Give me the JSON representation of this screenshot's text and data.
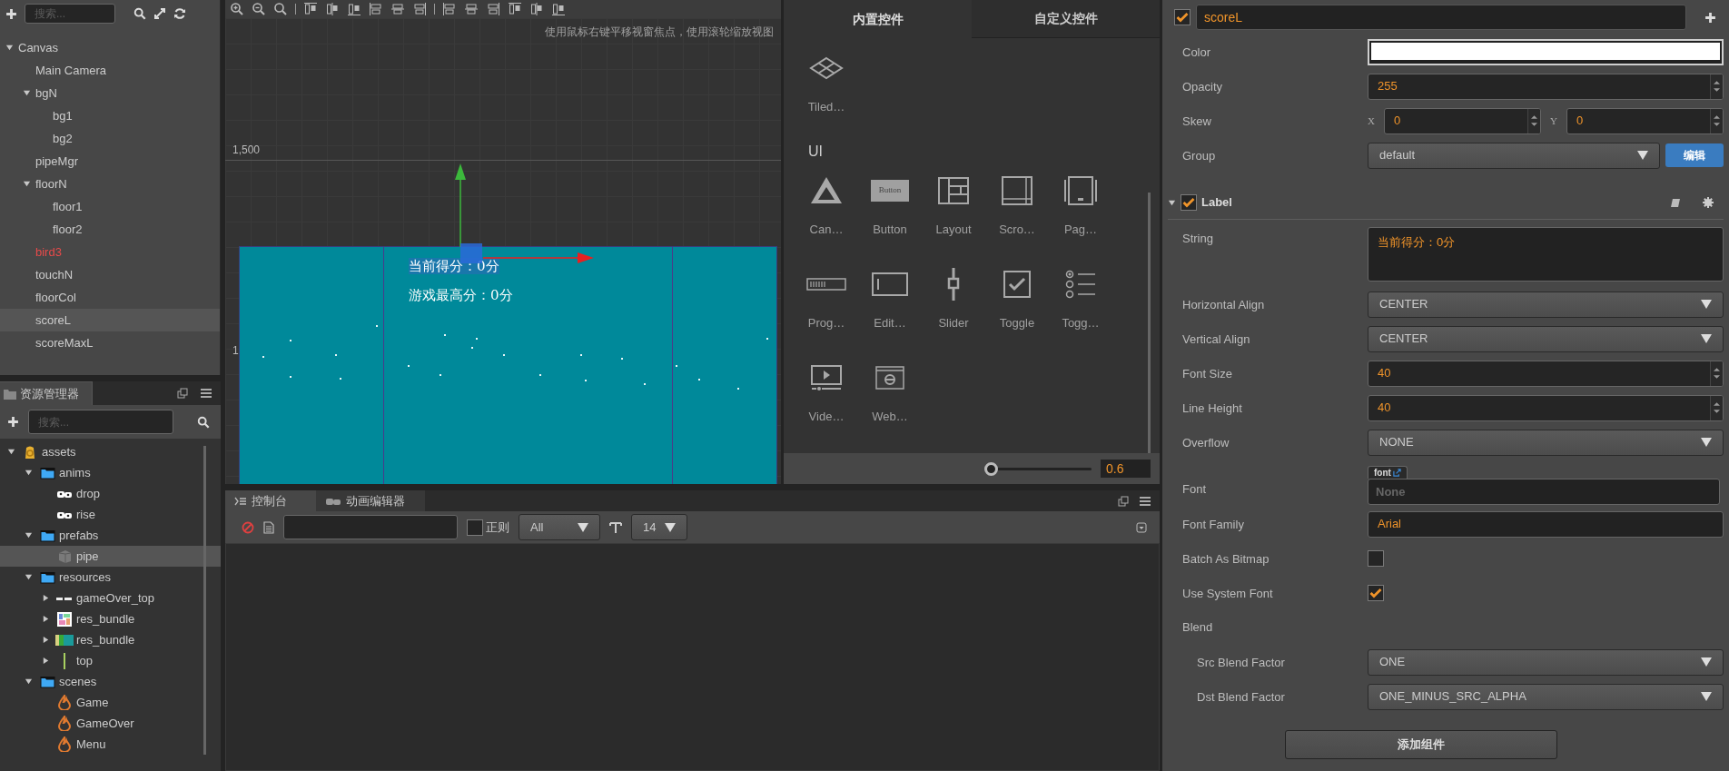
{
  "hierarchy": {
    "search_placeholder": "搜索...",
    "nodes": [
      {
        "name": "Canvas",
        "expanded": true,
        "selected": false,
        "color": "#cccccc",
        "children": [
          {
            "name": "Main Camera",
            "selected": false,
            "color": "#cccccc"
          },
          {
            "name": "bgN",
            "expanded": true,
            "selected": false,
            "color": "#cccccc",
            "children": [
              {
                "name": "bg1",
                "selected": false,
                "color": "#cccccc"
              },
              {
                "name": "bg2",
                "selected": false,
                "color": "#cccccc"
              }
            ]
          },
          {
            "name": "pipeMgr",
            "selected": false,
            "color": "#cccccc"
          },
          {
            "name": "floorN",
            "expanded": true,
            "selected": false,
            "color": "#cccccc",
            "children": [
              {
                "name": "floor1",
                "selected": false,
                "color": "#cccccc"
              },
              {
                "name": "floor2",
                "selected": false,
                "color": "#cccccc"
              }
            ]
          },
          {
            "name": "bird3",
            "selected": false,
            "color": "#e84a4a"
          },
          {
            "name": "touchN",
            "selected": false,
            "color": "#cccccc"
          },
          {
            "name": "floorCol",
            "selected": false,
            "color": "#cccccc"
          },
          {
            "name": "scoreL",
            "selected": true,
            "color": "#cccccc"
          },
          {
            "name": "scoreMaxL",
            "selected": false,
            "color": "#cccccc"
          }
        ]
      }
    ]
  },
  "assets": {
    "title": "资源管理器",
    "search_placeholder": "搜索...",
    "nodes": [
      {
        "name": "assets",
        "kind": "db",
        "expanded": true,
        "selected": false,
        "children": [
          {
            "name": "anims",
            "kind": "folder",
            "expanded": true,
            "selected": false,
            "children": [
              {
                "name": "drop",
                "kind": "anim",
                "selected": false
              },
              {
                "name": "rise",
                "kind": "anim",
                "selected": false
              }
            ]
          },
          {
            "name": "prefabs",
            "kind": "folder",
            "expanded": true,
            "selected": false,
            "children": [
              {
                "name": "pipe",
                "kind": "prefab",
                "selected": true
              }
            ]
          },
          {
            "name": "resources",
            "kind": "folder",
            "expanded": true,
            "selected": false,
            "children": [
              {
                "name": "gameOver_top",
                "kind": "strip",
                "expanded": false,
                "selected": false
              },
              {
                "name": "res_bundle",
                "kind": "atlas",
                "expanded": false,
                "selected": false
              },
              {
                "name": "res_bundle",
                "kind": "sheet",
                "expanded": false,
                "selected": false
              },
              {
                "name": "top",
                "kind": "bar",
                "expanded": false,
                "selected": false
              }
            ]
          },
          {
            "name": "scenes",
            "kind": "folder",
            "expanded": true,
            "selected": false,
            "children": [
              {
                "name": "Game",
                "kind": "scene",
                "selected": false
              },
              {
                "name": "GameOver",
                "kind": "scene",
                "selected": false
              },
              {
                "name": "Menu",
                "kind": "scene",
                "selected": false
              }
            ]
          }
        ]
      }
    ]
  },
  "scene": {
    "hint": "使用鼠标右键平移视窗焦点，使用滚轮缩放视图",
    "ruler_labels": [
      "1,500",
      "1"
    ],
    "labels": [
      {
        "text": "当前得分：0分",
        "selected": true
      },
      {
        "text": "游戏最高分：0分",
        "selected": false
      }
    ]
  },
  "widgets": {
    "tabs": [
      {
        "label": "内置控件",
        "selected": true
      },
      {
        "label": "自定义控件",
        "selected": false
      }
    ],
    "top_items": [
      {
        "label": "Tiled…",
        "kind": "tiled"
      }
    ],
    "section": "UI",
    "items": [
      {
        "label": "Can…",
        "kind": "canvas"
      },
      {
        "label": "Button",
        "kind": "button",
        "icon_text": "Button"
      },
      {
        "label": "Layout",
        "kind": "layout"
      },
      {
        "label": "Scro…",
        "kind": "scrollview"
      },
      {
        "label": "Pag…",
        "kind": "pageview"
      },
      {
        "label": "Prog…",
        "kind": "progressbar"
      },
      {
        "label": "Edit…",
        "kind": "editbox"
      },
      {
        "label": "Slider",
        "kind": "slider"
      },
      {
        "label": "Toggle",
        "kind": "toggle"
      },
      {
        "label": "Togg…",
        "kind": "togglegroup"
      },
      {
        "label": "Vide…",
        "kind": "video"
      },
      {
        "label": "Web…",
        "kind": "webview"
      }
    ],
    "zoom": {
      "level": 0,
      "value": "0.6"
    }
  },
  "console": {
    "tabs": [
      {
        "label": "控制台",
        "kind": "console",
        "selected": true
      },
      {
        "label": "动画编辑器",
        "kind": "animation",
        "selected": false
      }
    ],
    "regex": {
      "label": "正则",
      "checked": false
    },
    "log_level": "All",
    "font_size": "14"
  },
  "inspector": {
    "node": {
      "enabled": true,
      "name": "scoreL"
    },
    "properties": [
      {
        "kind": "color",
        "label": "Color",
        "color": "#ffffff"
      },
      {
        "kind": "number",
        "label": "Opacity",
        "value": "255"
      },
      {
        "kind": "vector",
        "label": "Skew",
        "fields": [
          {
            "axis": "X",
            "value": "0"
          },
          {
            "axis": "Y",
            "value": "0"
          }
        ]
      },
      {
        "kind": "select",
        "label": "Group",
        "value": "default",
        "button": "编辑"
      }
    ],
    "components": [
      {
        "title": "Label",
        "enabled": true,
        "expanded": true,
        "properties": [
          {
            "kind": "textarea",
            "label": "String",
            "value": "当前得分：0分"
          },
          {
            "kind": "select",
            "label": "Horizontal Align",
            "value": "CENTER"
          },
          {
            "kind": "select",
            "label": "Vertical Align",
            "value": "CENTER"
          },
          {
            "kind": "number",
            "label": "Font Size",
            "value": "40"
          },
          {
            "kind": "number",
            "label": "Line Height",
            "value": "40"
          },
          {
            "kind": "select",
            "label": "Overflow",
            "value": "NONE"
          },
          {
            "kind": "asset",
            "label": "Font",
            "tag": "font",
            "placeholder": "None"
          },
          {
            "kind": "text",
            "label": "Font Family",
            "value": "Arial"
          },
          {
            "kind": "checkbox",
            "label": "Batch As Bitmap",
            "checked": false
          },
          {
            "kind": "checkbox",
            "label": "Use System Font",
            "checked": true
          },
          {
            "kind": "group",
            "label": "Blend",
            "children": [
              {
                "kind": "select",
                "label": "Src Blend Factor",
                "value": "ONE"
              },
              {
                "kind": "select",
                "label": "Dst Blend Factor",
                "value": "ONE_MINUS_SRC_ALPHA"
              }
            ]
          }
        ]
      }
    ],
    "add_component": "添加组件"
  }
}
